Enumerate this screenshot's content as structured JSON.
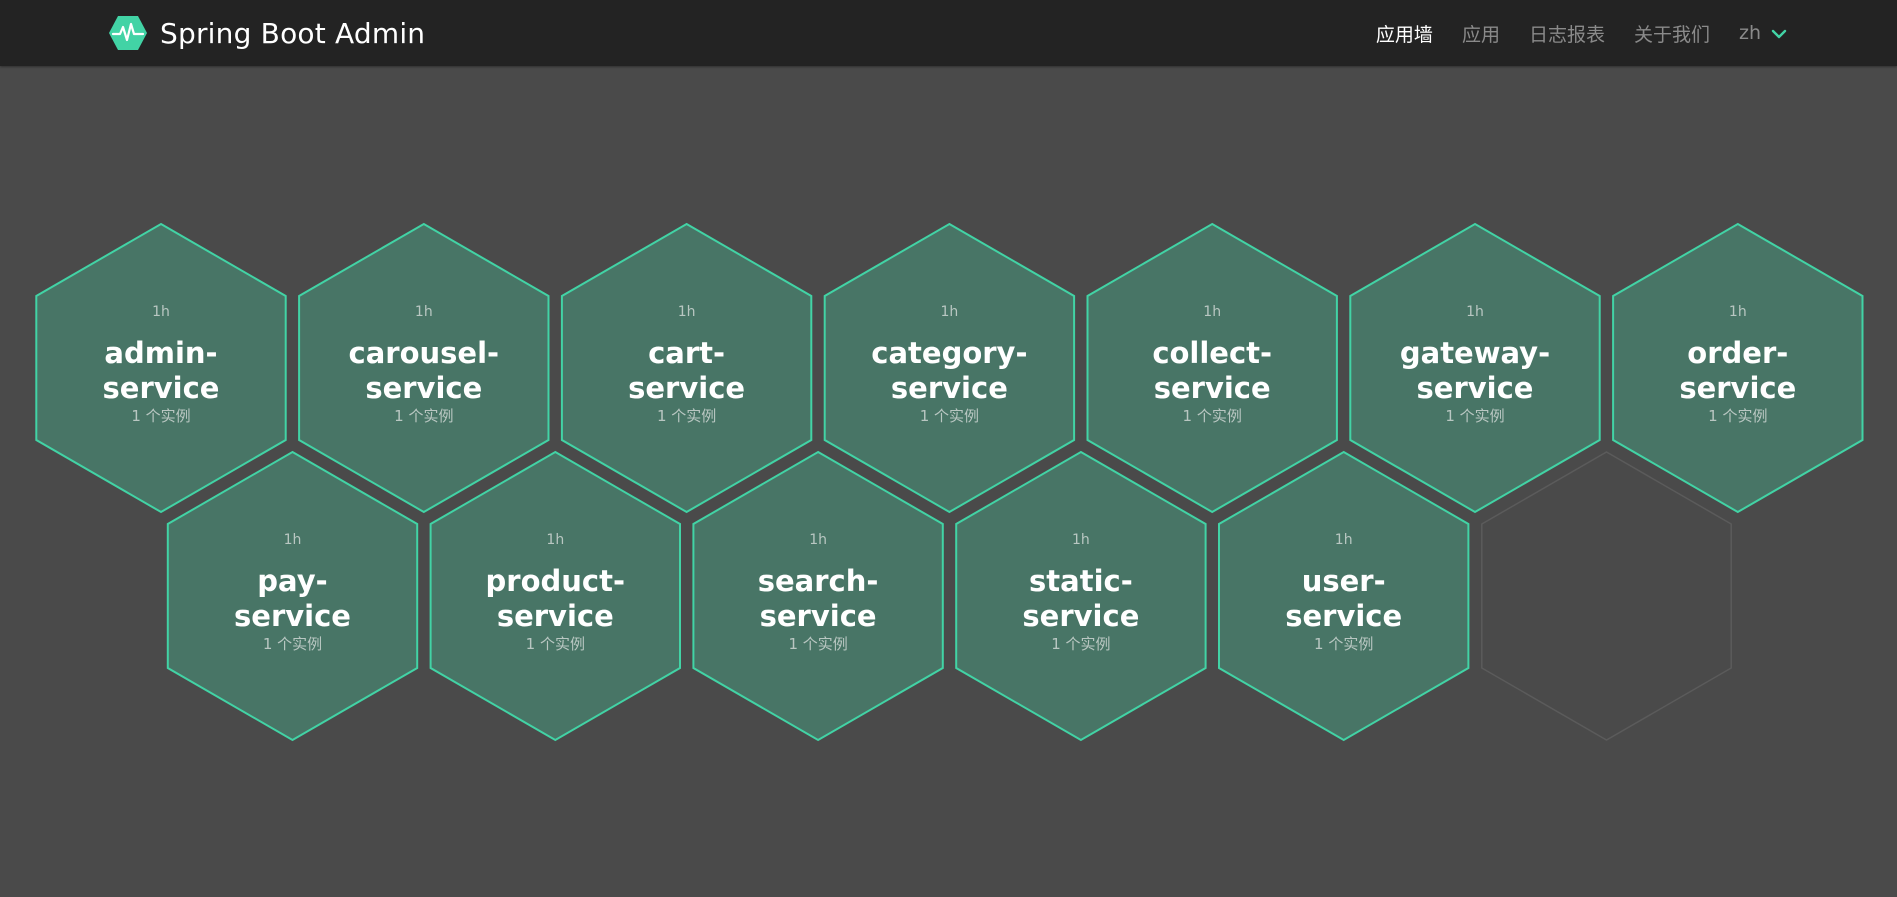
{
  "brand": {
    "title": "Spring Boot Admin",
    "logo_icon": "heartbeat-hexagon-icon",
    "accent_color": "#42d3a5"
  },
  "nav": {
    "items": [
      {
        "label": "应用墙",
        "active": true
      },
      {
        "label": "应用",
        "active": false
      },
      {
        "label": "日志报表",
        "active": false
      },
      {
        "label": "关于我们",
        "active": false
      }
    ],
    "language": {
      "label": "zh",
      "icon": "chevron-down-icon"
    }
  },
  "colors": {
    "navbar_bg": "#232323",
    "page_bg": "#4a4a4a",
    "hex_fill": "#487566",
    "hex_border": "#42d3a5"
  },
  "applications": [
    {
      "name_line1": "admin-",
      "name_line2": "service",
      "uptime": "1h",
      "instances": "1 个实例"
    },
    {
      "name_line1": "carousel-",
      "name_line2": "service",
      "uptime": "1h",
      "instances": "1 个实例"
    },
    {
      "name_line1": "cart-",
      "name_line2": "service",
      "uptime": "1h",
      "instances": "1 个实例"
    },
    {
      "name_line1": "category-",
      "name_line2": "service",
      "uptime": "1h",
      "instances": "1 个实例"
    },
    {
      "name_line1": "collect-",
      "name_line2": "service",
      "uptime": "1h",
      "instances": "1 个实例"
    },
    {
      "name_line1": "gateway-",
      "name_line2": "service",
      "uptime": "1h",
      "instances": "1 个实例"
    },
    {
      "name_line1": "order-",
      "name_line2": "service",
      "uptime": "1h",
      "instances": "1 个实例"
    },
    {
      "name_line1": "pay-",
      "name_line2": "service",
      "uptime": "1h",
      "instances": "1 个实例"
    },
    {
      "name_line1": "product-",
      "name_line2": "service",
      "uptime": "1h",
      "instances": "1 个实例"
    },
    {
      "name_line1": "search-",
      "name_line2": "service",
      "uptime": "1h",
      "instances": "1 个实例"
    },
    {
      "name_line1": "static-",
      "name_line2": "service",
      "uptime": "1h",
      "instances": "1 个实例"
    },
    {
      "name_line1": "user-",
      "name_line2": "service",
      "uptime": "1h",
      "instances": "1 个实例"
    }
  ]
}
